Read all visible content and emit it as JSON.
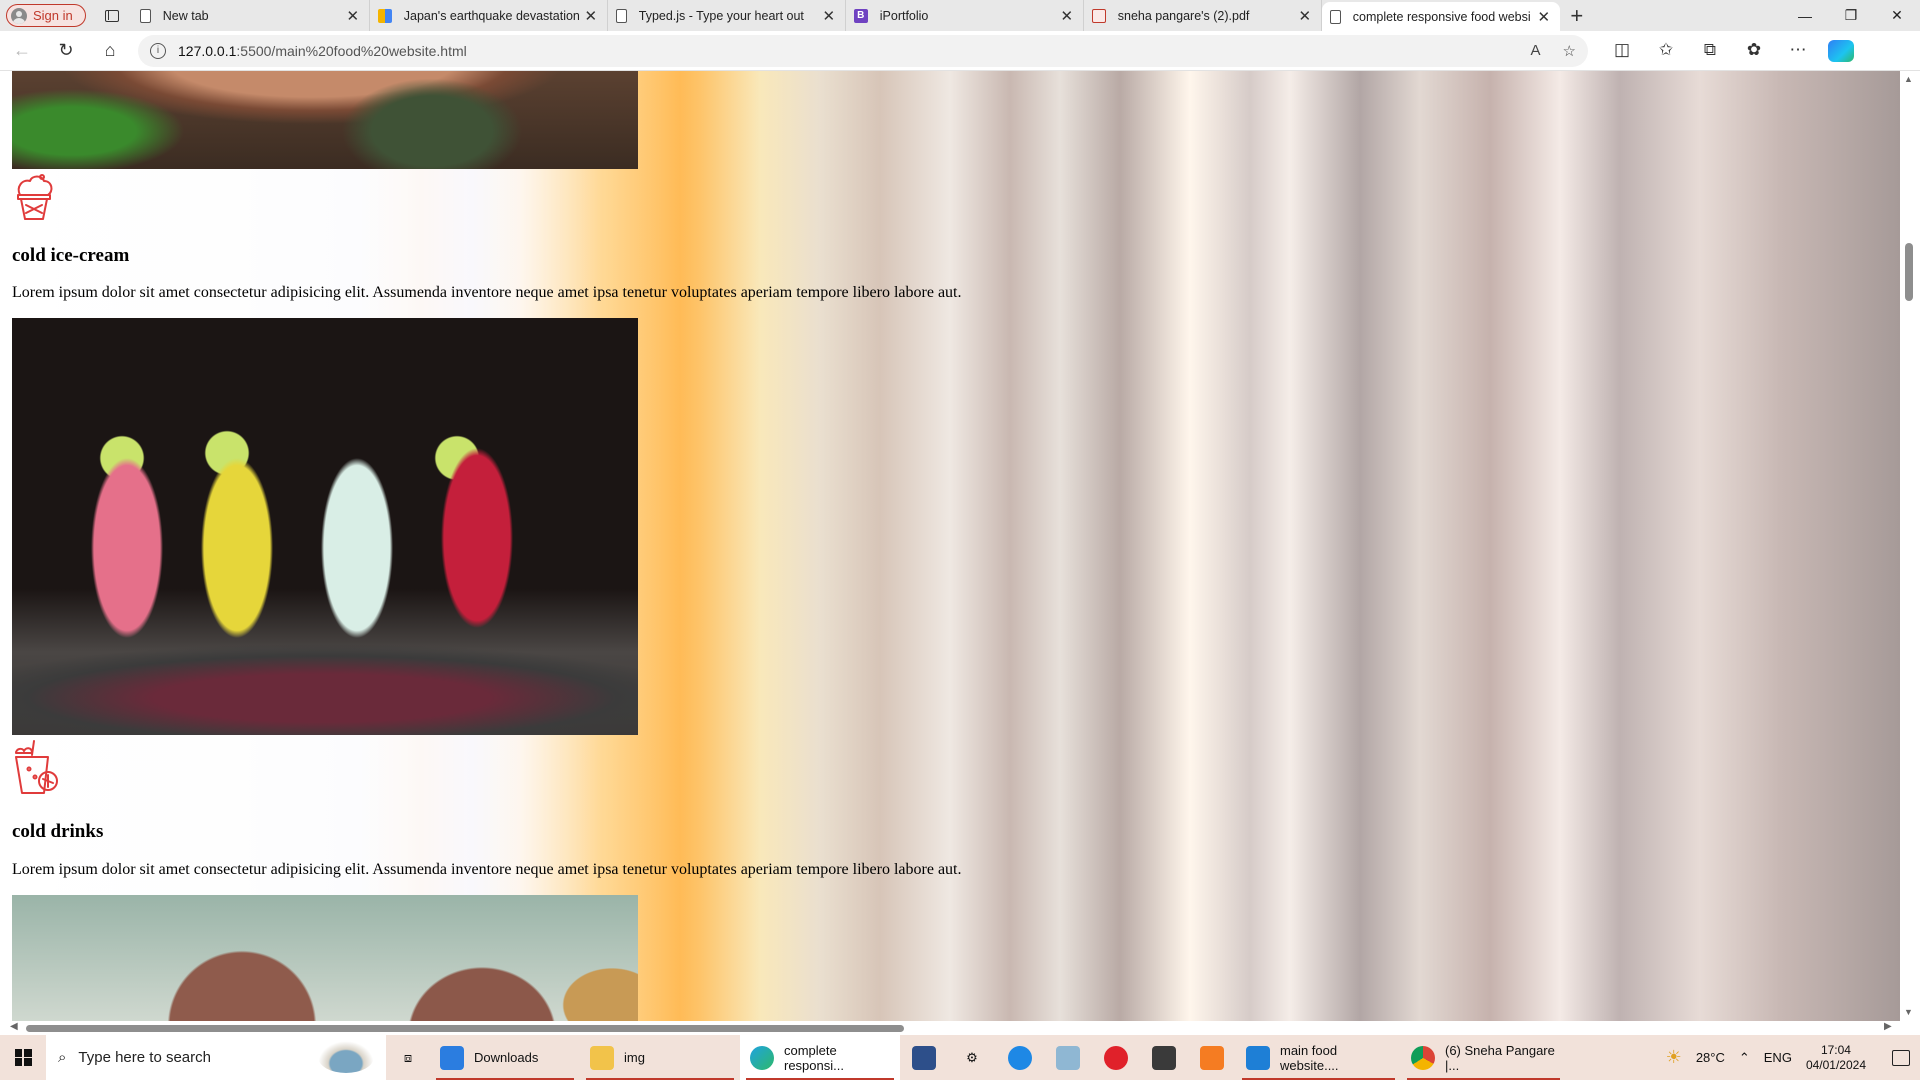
{
  "browser": {
    "signin_label": "Sign in",
    "tabs": [
      {
        "title": "New tab",
        "icon": "page-icon"
      },
      {
        "title": "Japan's earthquake devastation c",
        "icon": "news-icon"
      },
      {
        "title": "Typed.js - Type your heart out",
        "icon": "page-icon"
      },
      {
        "title": "iPortfolio",
        "icon": "bootstrap-icon",
        "glyph": "B"
      },
      {
        "title": "sneha pangare's (2).pdf",
        "icon": "pdf-icon"
      },
      {
        "title": "complete responsive food websi",
        "icon": "page-icon",
        "active": true
      }
    ],
    "url_host": "127.0.0.1",
    "url_path": ":5500/main%20food%20website.html"
  },
  "page": {
    "items": [
      {
        "title": "cold ice-cream",
        "description": "Lorem ipsum dolor sit amet consectetur adipisicing elit. Assumenda inventore neque amet ipsa tenetur voluptates aperiam tempore libero labore aut.",
        "icon": "ice-cream-icon"
      },
      {
        "title": "cold drinks",
        "description": "Lorem ipsum dolor sit amet consectetur adipisicing elit. Assumenda inventore neque amet ipsa tenetur voluptates aperiam tempore libero labore aut.",
        "icon": "cold-drink-icon"
      }
    ],
    "icon_color": "#e03b3b"
  },
  "taskbar": {
    "search_placeholder": "Type here to search",
    "apps": [
      {
        "label": "Downloads",
        "icon": "download-folder-icon"
      },
      {
        "label": "img",
        "icon": "folder-icon"
      },
      {
        "label": "complete responsi...",
        "icon": "edge-icon"
      },
      {
        "label": "main food website....",
        "icon": "vscode-icon"
      },
      {
        "label": "(6) Sneha Pangare |...",
        "icon": "chrome-icon"
      }
    ],
    "weather": "28°C",
    "language": "ENG",
    "time": "17:04",
    "date": "04/01/2024"
  },
  "colors": {
    "accent": "#c0392b",
    "taskbar_bg": "#f2e2da"
  }
}
